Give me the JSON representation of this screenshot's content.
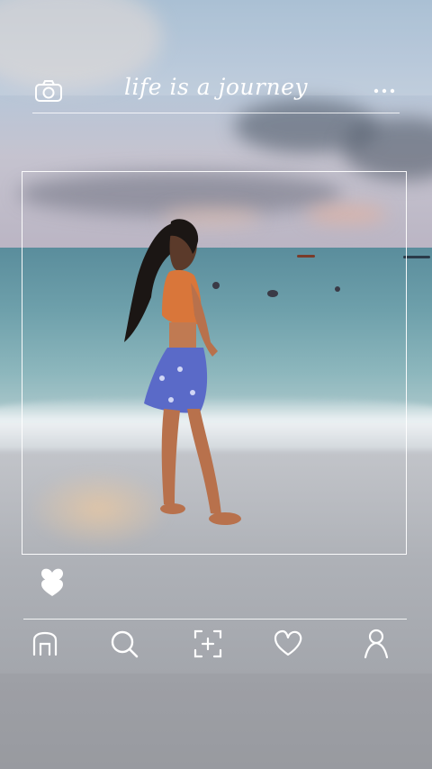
{
  "header": {
    "title": "life is a journey",
    "camera_icon": "camera-icon",
    "more_icon": "more-dots-icon"
  },
  "post": {
    "like_icon": "heart-filled-icon"
  },
  "bottom_nav": {
    "items": [
      {
        "icon": "home-icon"
      },
      {
        "icon": "search-icon"
      },
      {
        "icon": "add-post-icon"
      },
      {
        "icon": "heart-outline-icon"
      },
      {
        "icon": "profile-icon"
      }
    ]
  },
  "colors": {
    "overlay_lines": "#ffffff",
    "sky": "#b7c6d8",
    "sea": "#6ea0ab",
    "sand": "#aeb1b7"
  }
}
